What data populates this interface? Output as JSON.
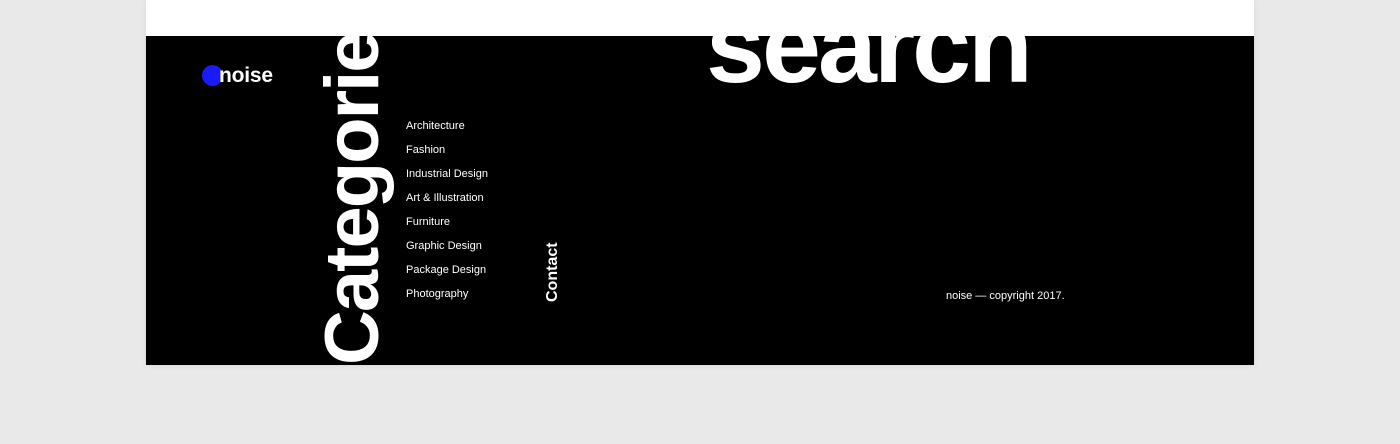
{
  "brand": {
    "name": "noise",
    "accent_color": "#1a1aff"
  },
  "categories": {
    "heading": "Categories",
    "items": [
      {
        "label": "Architecture"
      },
      {
        "label": "Fashion"
      },
      {
        "label": "Industrial Design"
      },
      {
        "label": "Art & Illustration"
      },
      {
        "label": "Furniture"
      },
      {
        "label": "Graphic Design"
      },
      {
        "label": "Package Design"
      },
      {
        "label": "Photography"
      }
    ]
  },
  "contact": {
    "label": "Contact"
  },
  "search": {
    "heading": "search"
  },
  "footer": {
    "copyright": "noise — copyright 2017."
  }
}
